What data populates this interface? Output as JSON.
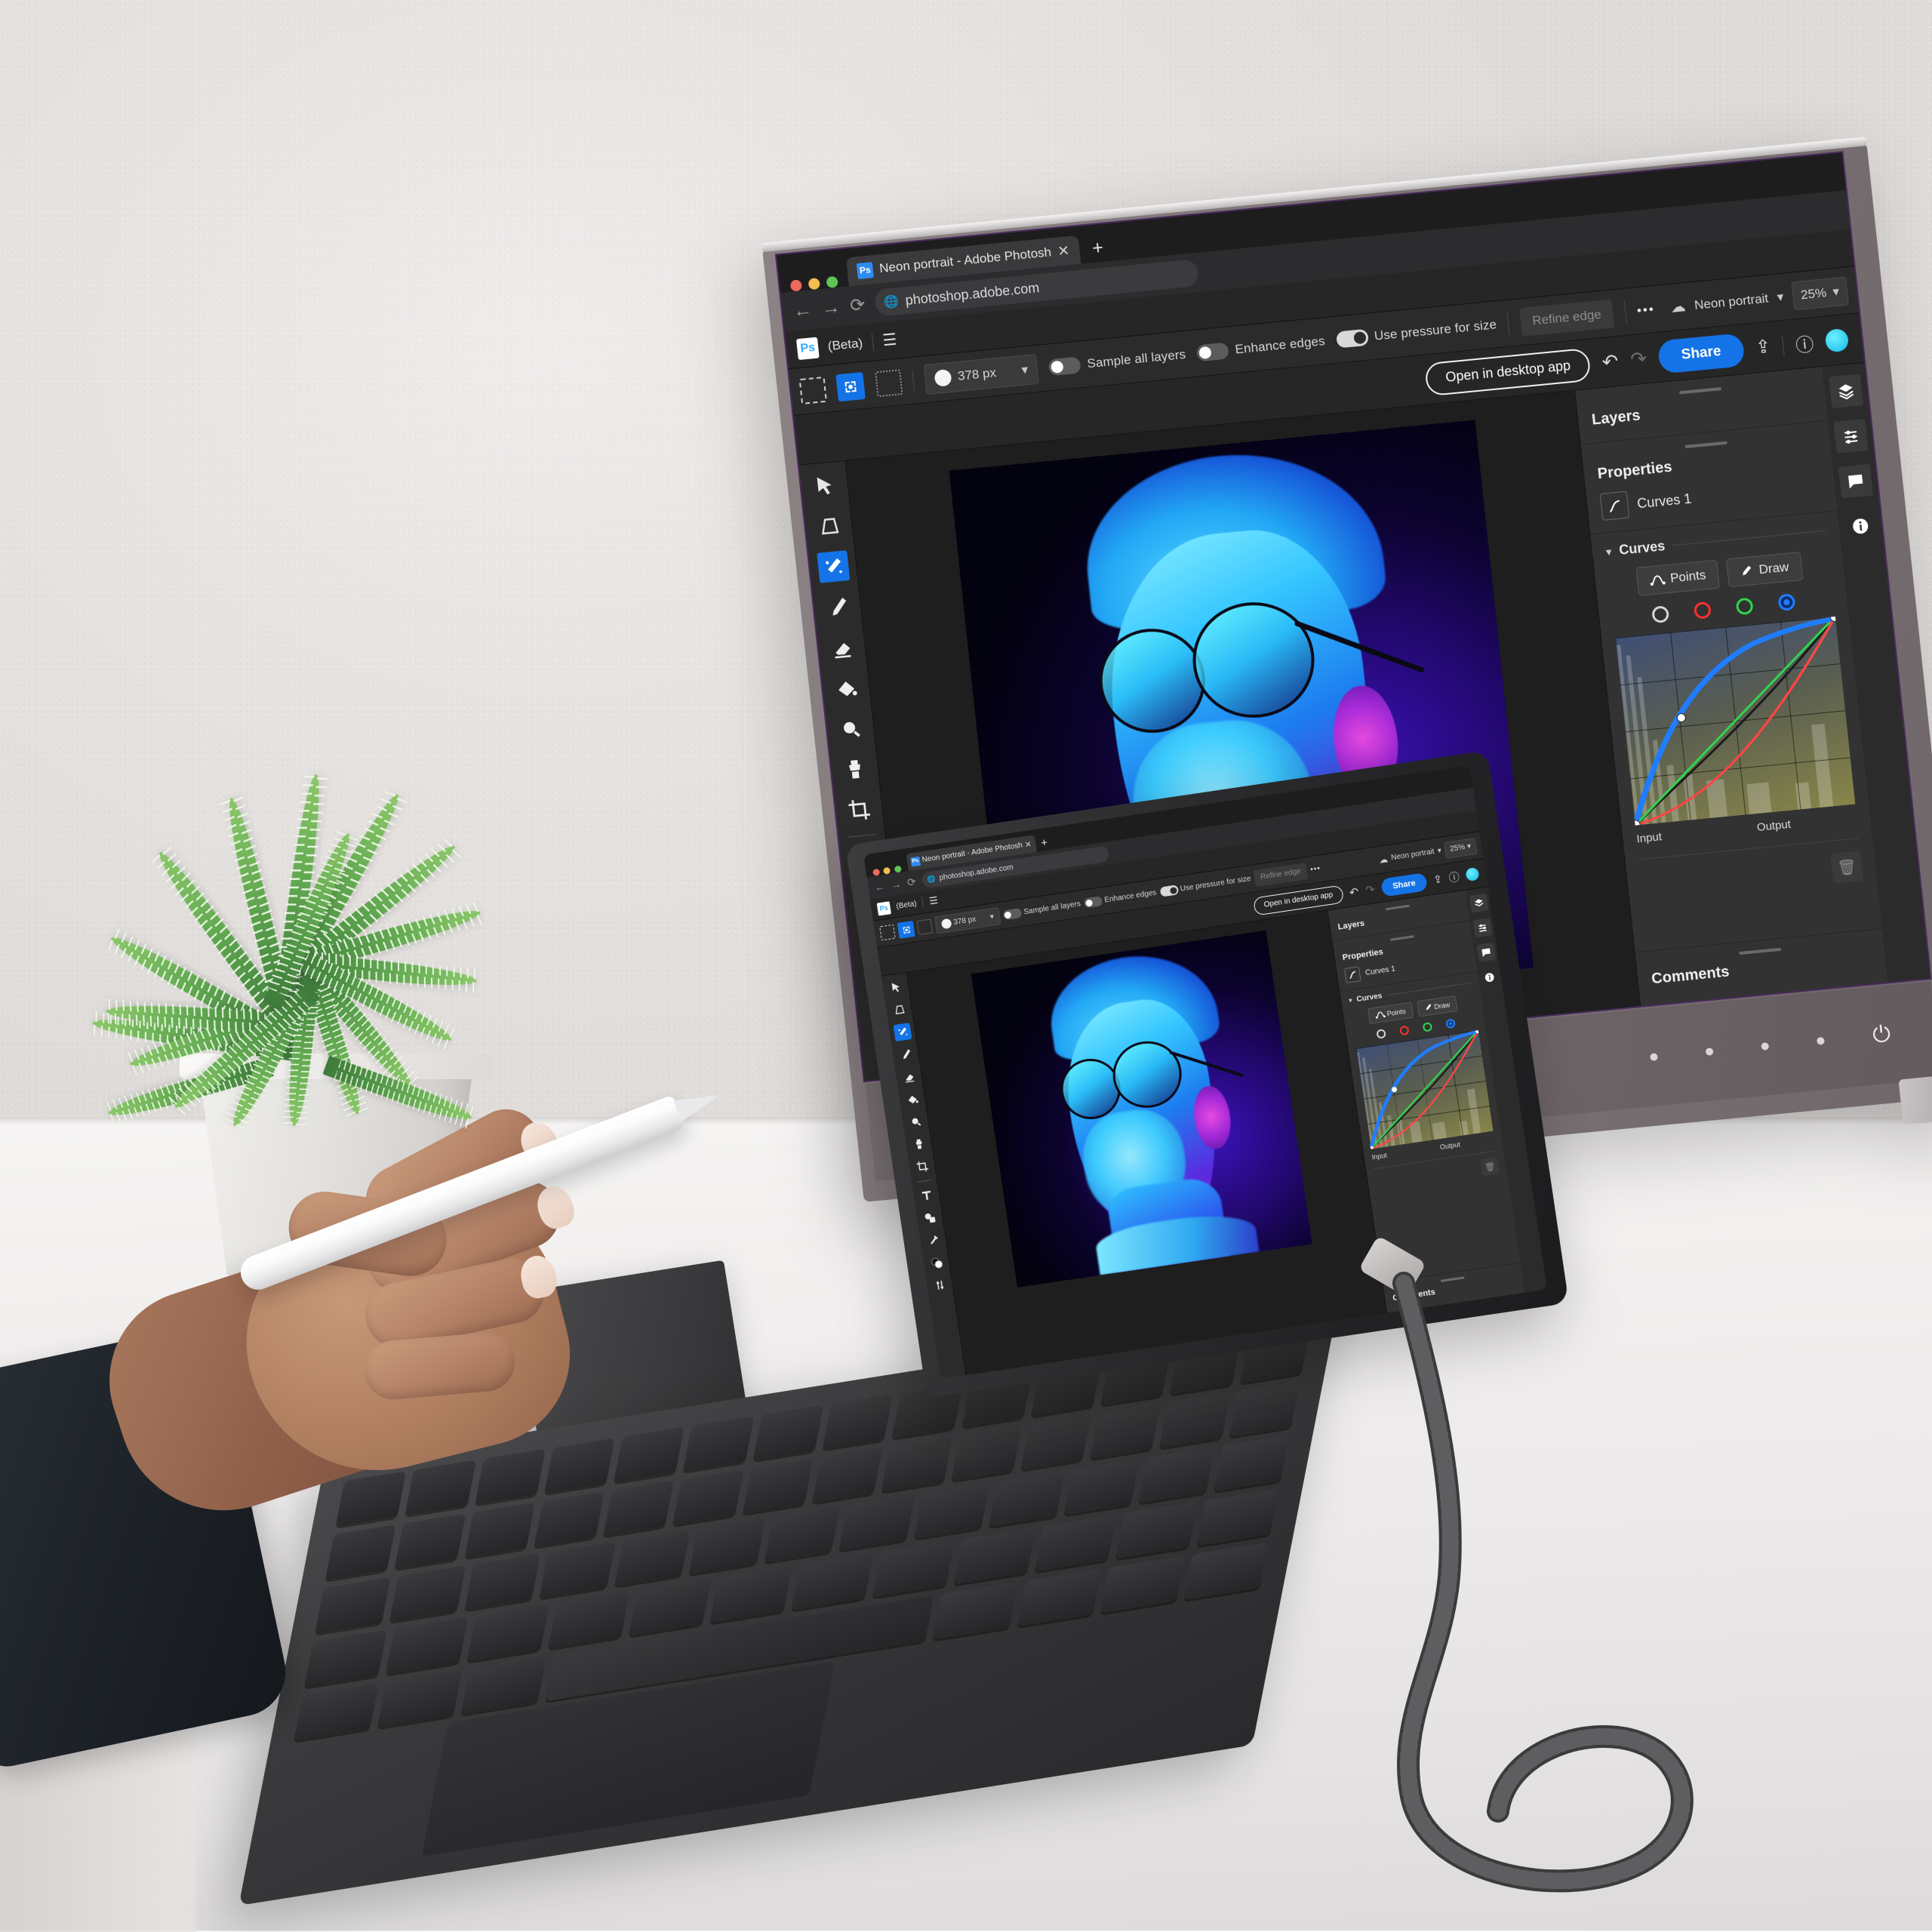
{
  "scene": {
    "description": "Desk workspace with external monitor and tablet both running Adobe Photoshop on the web",
    "wall_color": "#e6e3e1",
    "desk_color": "#f2f0ef"
  },
  "browser": {
    "traffic_lights": [
      "#ee6a5f",
      "#f5bd4f",
      "#61c454"
    ],
    "tab": {
      "favicon_label": "Ps",
      "title": "Neon portrait - Adobe Photosh",
      "close_icon": "close-icon"
    },
    "new_tab_label": "+",
    "nav": {
      "back_icon": "arrow-left-icon",
      "forward_icon": "arrow-right-icon",
      "reload_icon": "reload-icon"
    },
    "url": "photoshop.adobe.com",
    "site_icon": "globe-icon",
    "toolbar_right": {
      "extensions_icon": "puzzle-icon",
      "sidepanel_icon": "sidepanel-icon",
      "avatar_icon": "avatar-icon",
      "menu_icon": "kebab-menu-icon"
    }
  },
  "photoshop": {
    "app_logo": "Ps",
    "beta_label": "(Beta)",
    "hamburger_icon": "hamburger-icon",
    "tools": [
      {
        "name": "move-tool",
        "icon": "cursor-arrow-icon",
        "active": false
      },
      {
        "name": "transform-tool",
        "icon": "transform-icon",
        "active": false
      },
      {
        "name": "object-selection-tool",
        "icon": "magic-wand-select-icon",
        "active": true
      },
      {
        "name": "brush-tool",
        "icon": "brush-icon",
        "active": false
      },
      {
        "name": "eraser-tool",
        "icon": "eraser-icon",
        "active": false
      },
      {
        "name": "paint-bucket-tool",
        "icon": "paint-bucket-icon",
        "active": false
      },
      {
        "name": "spot-heal-tool",
        "icon": "spot-heal-icon",
        "active": false
      },
      {
        "name": "clone-stamp-tool",
        "icon": "clone-stamp-icon",
        "active": false
      },
      {
        "name": "crop-tool",
        "icon": "crop-icon",
        "active": false
      },
      {
        "name": "type-tool",
        "icon": "type-T-icon",
        "active": false
      },
      {
        "name": "shapes-tool",
        "icon": "shapes-icon",
        "active": false
      },
      {
        "name": "eyedropper-tool",
        "icon": "eyedropper-icon",
        "active": false
      },
      {
        "name": "color-swatches",
        "icon": "foreground-background-color-icon",
        "active": false
      },
      {
        "name": "more-tools",
        "icon": "sliders-vertical-icon",
        "active": false
      }
    ],
    "options_bar": {
      "mode_new_label": "new-selection-icon",
      "mode_add_label": "add-to-selection-icon",
      "mode_subtract_label": "subtract-from-selection-icon",
      "brush_swatch": "round-brush-swatch",
      "brush_size": "378 px",
      "brush_size_caret": "chevron-down-icon",
      "sample_all_layers": {
        "label": "Sample all layers",
        "on": false
      },
      "enhance_edges": {
        "label": "Enhance edges",
        "on": false
      },
      "use_pressure_for_size": {
        "label": "Use pressure for size",
        "on": true
      },
      "refine_edge_label": "Refine edge",
      "more_options_label": "•••",
      "cloud_icon": "cloud-saved-icon",
      "document_name": "Neon portrait",
      "document_caret": "chevron-down-icon",
      "zoom_level": "25%",
      "zoom_caret": "chevron-down-icon",
      "panel_collapse_icon": "chevron-down-icon"
    },
    "actions": {
      "open_in_desktop_app": "Open in desktop app",
      "undo_icon": "undo-icon",
      "redo_icon": "redo-icon",
      "share_label": "Share",
      "export_icon": "export-upload-icon",
      "help_icon": "help-circle-icon",
      "status_icon": "user-presence-icon"
    },
    "panels": {
      "layers_title": "Layers",
      "properties_title": "Properties",
      "adjustment_layer_name": "Curves 1",
      "adjustment_layer_icon": "curves-adjustment-icon",
      "curves_section_title": "Curves",
      "curves_collapse_icon": "chevron-down-icon",
      "points_label": "Points",
      "points_icon": "curve-points-icon",
      "draw_label": "Draw",
      "draw_icon": "pencil-icon",
      "channels": [
        {
          "name": "rgb-channel",
          "color": "#d6d6d6",
          "selected": false
        },
        {
          "name": "red-channel",
          "color": "#ff2f2f",
          "selected": false
        },
        {
          "name": "green-channel",
          "color": "#2fd64f",
          "selected": false
        },
        {
          "name": "blue-channel",
          "color": "#1f7dff",
          "selected": true
        }
      ],
      "axis_input_label": "Input",
      "axis_output_label": "Output",
      "delete_icon": "trash-icon",
      "comments_title": "Comments"
    },
    "right_rail": [
      {
        "name": "layers-rail-icon",
        "icon": "layers-stack-icon"
      },
      {
        "name": "adjustments-rail-icon",
        "icon": "sliders-icon"
      },
      {
        "name": "comments-rail-icon",
        "icon": "comment-bubble-icon"
      },
      {
        "name": "info-rail-icon",
        "icon": "info-circle-icon"
      }
    ]
  },
  "chart_data": {
    "type": "line",
    "title": "Curves",
    "xlabel": "Input",
    "ylabel": "Output",
    "xlim": [
      0,
      255
    ],
    "ylim": [
      0,
      255
    ],
    "grid": true,
    "legend": "channel swatches above graph",
    "series": [
      {
        "name": "Blue",
        "color": "#1f7dff",
        "selected": true,
        "points": [
          [
            0,
            0
          ],
          [
            90,
            168
          ],
          [
            255,
            255
          ]
        ],
        "control_points": [
          [
            0,
            0
          ],
          [
            90,
            168
          ],
          [
            255,
            255
          ]
        ]
      },
      {
        "name": "RGB composite",
        "color": "#1a1a1a",
        "selected": false,
        "points": [
          [
            0,
            0
          ],
          [
            128,
            150
          ],
          [
            255,
            255
          ]
        ]
      },
      {
        "name": "Green",
        "color": "#2fd64f",
        "selected": false,
        "points": [
          [
            0,
            0
          ],
          [
            255,
            255
          ]
        ]
      },
      {
        "name": "Red",
        "color": "#ff2f2f",
        "selected": false,
        "points": [
          [
            0,
            0
          ],
          [
            128,
            100
          ],
          [
            255,
            255
          ]
        ]
      }
    ],
    "histogram_note": "luminance histogram shaded behind curve, peaking in shadows and far highlights"
  },
  "artwork": {
    "title": "Neon portrait",
    "subject": "man in profile wearing round sunglasses, lit with cyan and magenta neon",
    "palette": [
      "#5ad8ff",
      "#1d7ef0",
      "#7a1fd4",
      "#e64ae0",
      "#03020f"
    ]
  },
  "monitor": {
    "bezel_color": "#7a7174",
    "accent_edge_color": "#5b1fb0",
    "osd_buttons": [
      "osd-dot-1",
      "osd-dot-2",
      "osd-dot-3",
      "osd-dot-4"
    ],
    "power_icon": "power-icon"
  },
  "tablet": {
    "body_color": "#2a2a2c",
    "keyboard_name": "magic-keyboard",
    "stand_name": "tablet-stand"
  },
  "accessories": {
    "stylus_name": "stylus-pen",
    "cable_name": "usb-c-braided-cable",
    "connector_name": "usb-c-connector",
    "plant_name": "fern-plant",
    "pot_name": "ceramic-planter",
    "hand_name": "hand-holding-stylus"
  }
}
